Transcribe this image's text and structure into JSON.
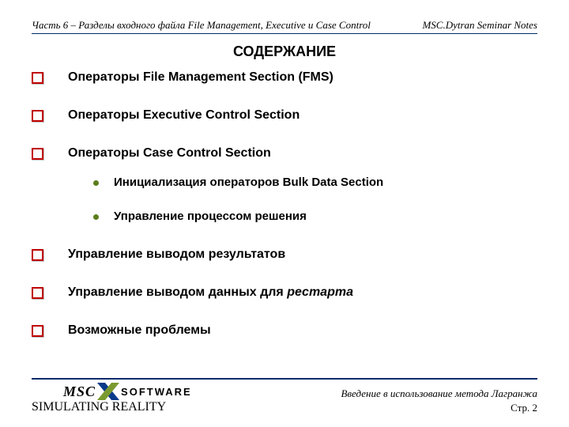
{
  "header": {
    "left": "Часть 6 – Разделы входного файла File Management, Executive и Case Control",
    "right": "MSC.Dytran Seminar Notes"
  },
  "title": "СОДЕРЖАНИЕ",
  "items": [
    {
      "text": "Операторы File Management Section (FMS)"
    },
    {
      "text": "Операторы Executive Control Section"
    },
    {
      "text": "Операторы Case Control Section",
      "children": [
        {
          "text": "Инициализация операторов Bulk Data Section"
        },
        {
          "text": "Управление процессом решения"
        }
      ]
    },
    {
      "text": "Управление выводом результатов"
    },
    {
      "text_prefix": "Управление выводом данных для ",
      "text_em": "рестарта"
    },
    {
      "text": "Возможные проблемы"
    }
  ],
  "logo": {
    "msc": "MSC",
    "software": "SOFTWARE",
    "tagline": "SIMULATING REALITY"
  },
  "footer": {
    "line1": "Введение в использование метода Лагранжа",
    "page": "Стр. 2"
  }
}
